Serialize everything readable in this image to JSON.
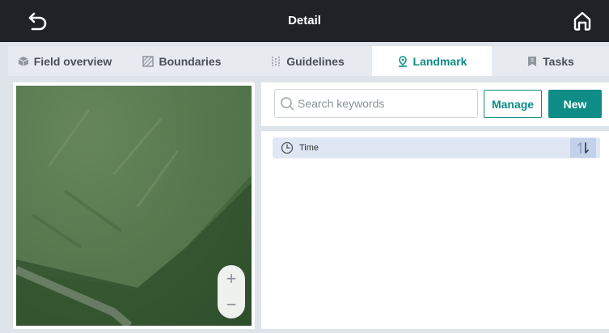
{
  "header": {
    "title": "Detail",
    "back_icon": "back-arrow-icon",
    "home_icon": "home-icon"
  },
  "tabs": [
    {
      "label": "Field overview",
      "icon": "cube-icon",
      "active": false
    },
    {
      "label": "Boundaries",
      "icon": "hatched-square-icon",
      "active": false
    },
    {
      "label": "Guidelines",
      "icon": "guideline-icon",
      "active": false
    },
    {
      "label": "Landmark",
      "icon": "location-pin-icon",
      "active": true
    },
    {
      "label": "Tasks",
      "icon": "bookmark-icon",
      "active": false
    }
  ],
  "map": {
    "zoom_in": "+",
    "zoom_out": "−"
  },
  "search": {
    "placeholder": "Search keywords"
  },
  "actions": {
    "manage_label": "Manage",
    "new_label": "New"
  },
  "list": {
    "sort_label": "Time",
    "sort_icon": "sort-toggle-icon"
  },
  "colors": {
    "accent": "#0e8c86",
    "topbar": "#1f2328",
    "sort_row_bg": "#dfe7f4"
  }
}
